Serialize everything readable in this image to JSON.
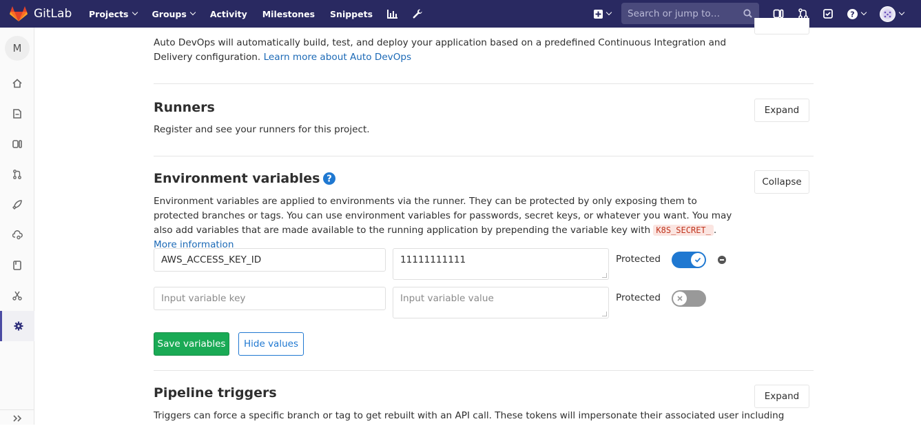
{
  "navbar": {
    "brand": "GitLab",
    "links": [
      "Projects",
      "Groups",
      "Activity",
      "Milestones",
      "Snippets"
    ],
    "search_placeholder": "Search or jump to…"
  },
  "sidebar": {
    "project_initial": "M"
  },
  "autodevops": {
    "desc": "Auto DevOps will automatically build, test, and deploy your application based on a predefined Continuous Integration and Delivery configuration.",
    "link": "Learn more about Auto DevOps"
  },
  "runners": {
    "title": "Runners",
    "desc": "Register and see your runners for this project.",
    "button": "Expand"
  },
  "env": {
    "title": "Environment variables",
    "button": "Collapse",
    "desc_before": "Environment variables are applied to environments via the runner. They can be protected by only exposing them to protected branches or tags. You can use environment variables for passwords, secret keys, or whatever you want. You may also add variables that are made available to the running application by prepending the variable key with",
    "code": "K8S_SECRET_",
    "link": "More information",
    "rows": [
      {
        "key": "AWS_ACCESS_KEY_ID",
        "value": "11111111111",
        "protected_label": "Protected",
        "protected": true
      },
      {
        "key_placeholder": "Input variable key",
        "value_placeholder": "Input variable value",
        "protected_label": "Protected",
        "protected": false
      }
    ],
    "save_button": "Save variables",
    "hide_button": "Hide values"
  },
  "triggers": {
    "title": "Pipeline triggers",
    "button": "Expand",
    "desc": "Triggers can force a specific branch or tag to get rebuilt with an API call. These tokens will impersonate their associated user including"
  },
  "colors": {
    "navbar": "#292961",
    "primary": "#1f78d1",
    "success": "#1aaa55"
  }
}
